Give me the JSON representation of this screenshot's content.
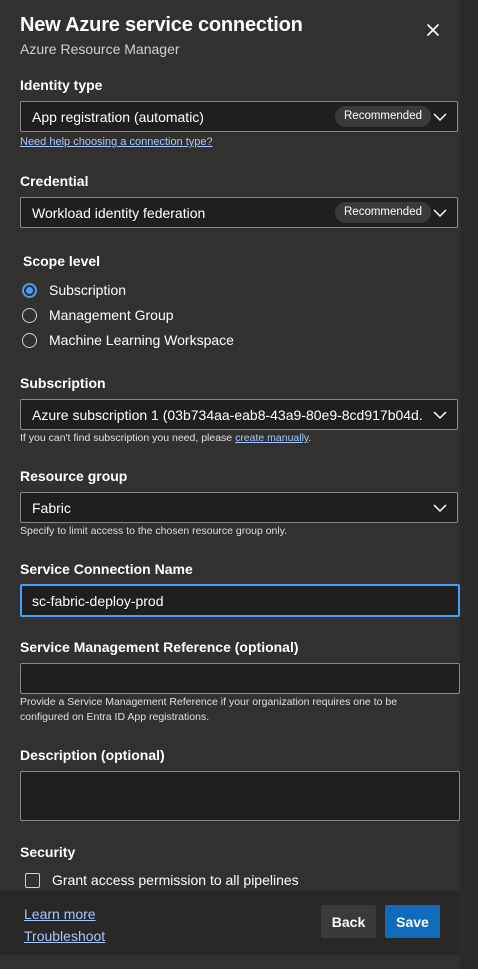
{
  "header": {
    "title": "New Azure service connection",
    "subtitle": "Azure Resource Manager"
  },
  "identity": {
    "label": "Identity type",
    "value": "App registration (automatic)",
    "badge": "Recommended",
    "help_link": "Need help choosing a connection type?"
  },
  "credential": {
    "label": "Credential",
    "value": "Workload identity federation",
    "badge": "Recommended"
  },
  "scope": {
    "label": "Scope level",
    "options": [
      "Subscription",
      "Management Group",
      "Machine Learning Workspace"
    ],
    "selected": "Subscription"
  },
  "subscription": {
    "label": "Subscription",
    "value": "Azure subscription 1 (03b734aa-eab8-43a9-80e9-8cd917b04d...",
    "help_prefix": "If you can't find subscription you need, please ",
    "help_link": "create manually",
    "help_suffix": "."
  },
  "resource_group": {
    "label": "Resource group",
    "value": "Fabric",
    "help": "Specify to limit access to the chosen resource group only."
  },
  "service_connection_name": {
    "label": "Service Connection Name",
    "value": "sc-fabric-deploy-prod"
  },
  "service_management_reference": {
    "label": "Service Management Reference (optional)",
    "value": "",
    "help_line1": "Provide a Service Management Reference if your organization requires one to be",
    "help_line2": "configured on Entra ID App registrations."
  },
  "description": {
    "label": "Description (optional)",
    "value": ""
  },
  "security": {
    "label": "Security",
    "grant_label": "Grant access permission to all pipelines",
    "grant_checked": false
  },
  "footer": {
    "learn_more": "Learn more",
    "troubleshoot": "Troubleshoot",
    "back": "Back",
    "save": "Save"
  },
  "colors": {
    "panel_bg": "#323130",
    "accent": "#0f6cbd",
    "link": "#a6c8ff",
    "focus_border": "#479ef5"
  }
}
